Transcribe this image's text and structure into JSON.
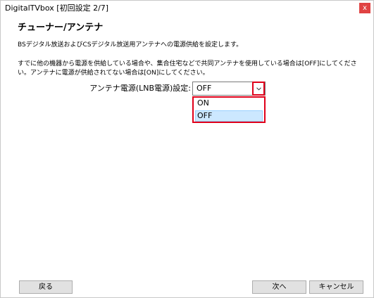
{
  "window": {
    "title": "DigitalTVbox [初回設定 2/7]",
    "close_label": "x"
  },
  "content": {
    "heading": "チューナー/アンテナ",
    "description1": "BSデジタル放送およびCSデジタル放送用アンテナへの電源供給を設定します。",
    "description2": "すでに他の機器から電源を供給している場合や、集合住宅などで共同アンテナを使用している場合は[OFF]にしてください。アンテナに電源が供給されてない場合は[ON]にしてください。"
  },
  "antenna_power": {
    "label": "アンテナ電源(LNB電源)設定:",
    "selected": "OFF",
    "options": [
      "ON",
      "OFF"
    ]
  },
  "buttons": {
    "back": "戻る",
    "next": "次へ",
    "cancel": "キャンセル"
  },
  "colors": {
    "highlight": "#e0001a",
    "selection": "#cce8ff"
  }
}
